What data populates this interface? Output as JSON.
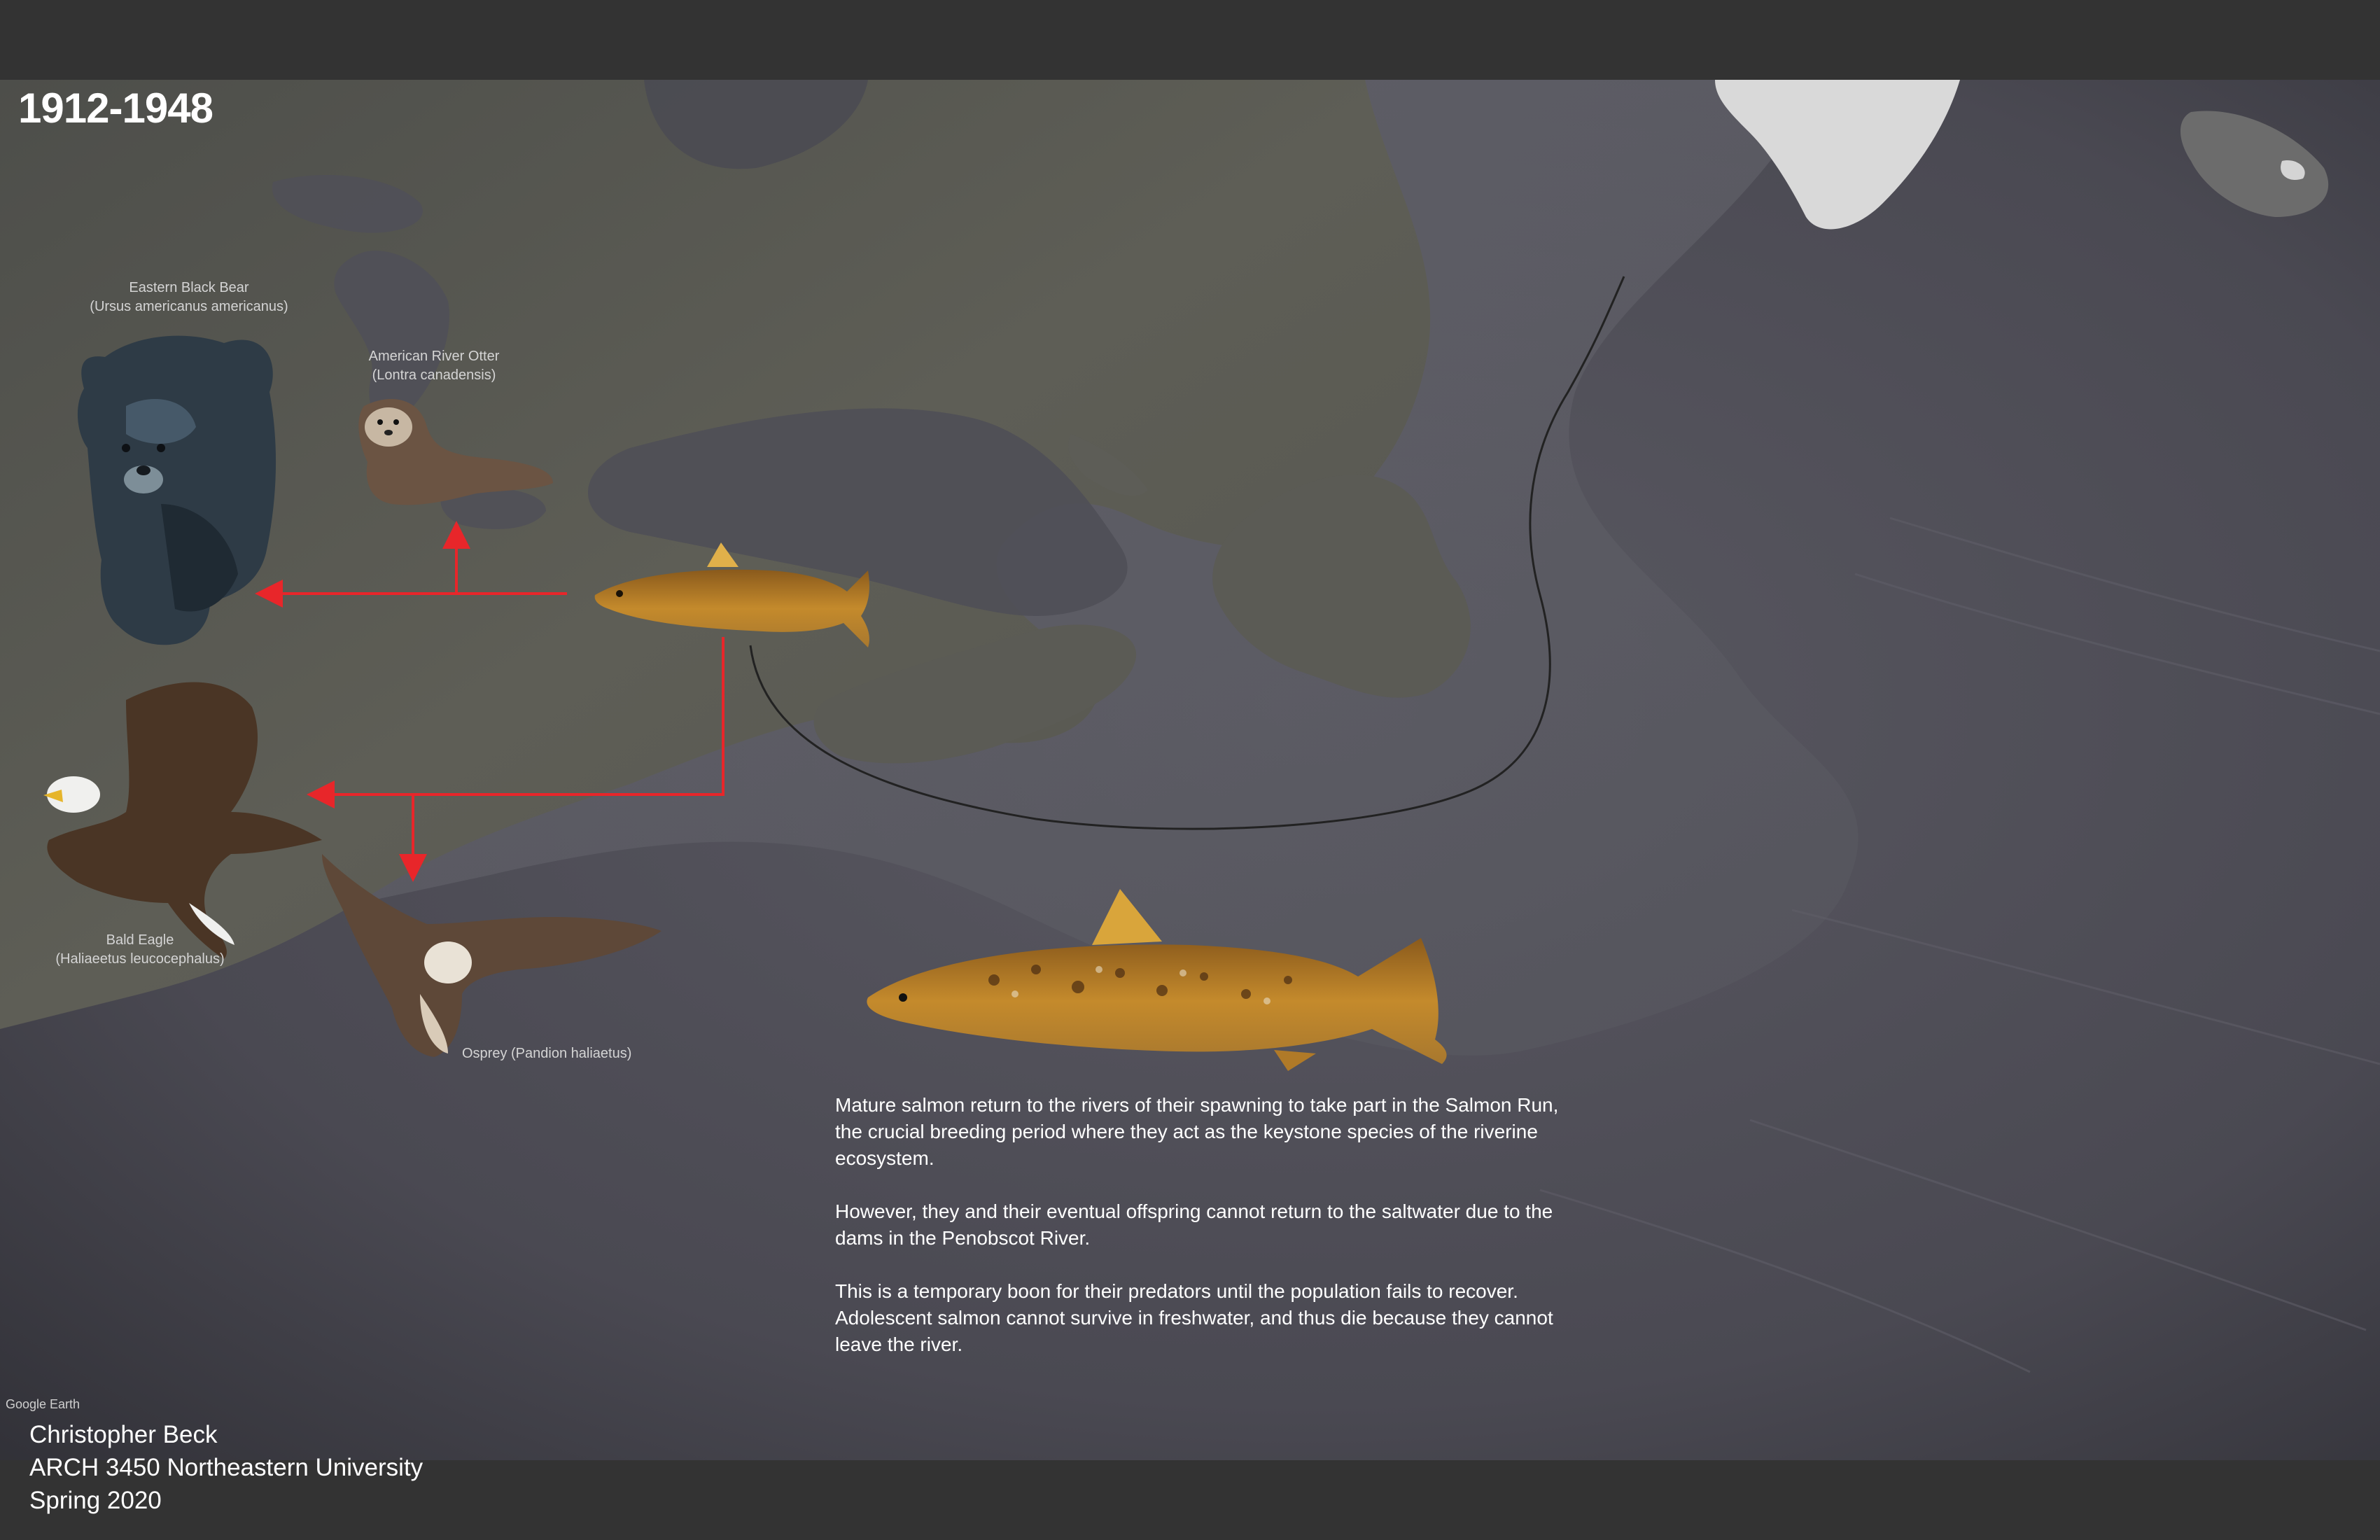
{
  "era": "1912-1948",
  "species": {
    "bear": {
      "common": "Eastern Black Bear",
      "latin": "(Ursus americanus americanus)"
    },
    "otter": {
      "common": "American River Otter",
      "latin": "(Lontra canadensis)"
    },
    "eagle": {
      "common": "Bald Eagle",
      "latin": "(Haliaeetus leucocephalus)"
    },
    "osprey": {
      "label": "Osprey (Pandion haliaetus)"
    }
  },
  "description": {
    "p1": "Mature salmon return to the rivers of their spawning to take part in the Salmon Run, the crucial breeding period where they act as the keystone species of the riverine ecosystem.",
    "p2": "However, they and their eventual offspring cannot return to the saltwater due to the dams in the Penobscot River.",
    "p3": "This is a temporary boon for their predators until the population fails to recover. Adolescent salmon cannot survive in freshwater, and thus die because they cannot leave the river."
  },
  "map_provider": "Google Earth",
  "credits": {
    "author": "Christopher Beck",
    "course": "ARCH 3450 Northeastern University",
    "term": "Spring 2020"
  },
  "colors": {
    "arrow": "#e8262a",
    "ocean": "#4e4d55",
    "land": "#5a5a52",
    "ice": "#d9d9d9",
    "route": "#222222"
  },
  "icons": [
    "bear-photo",
    "otter-photo",
    "eagle-photo",
    "osprey-photo",
    "salmon-photo"
  ]
}
